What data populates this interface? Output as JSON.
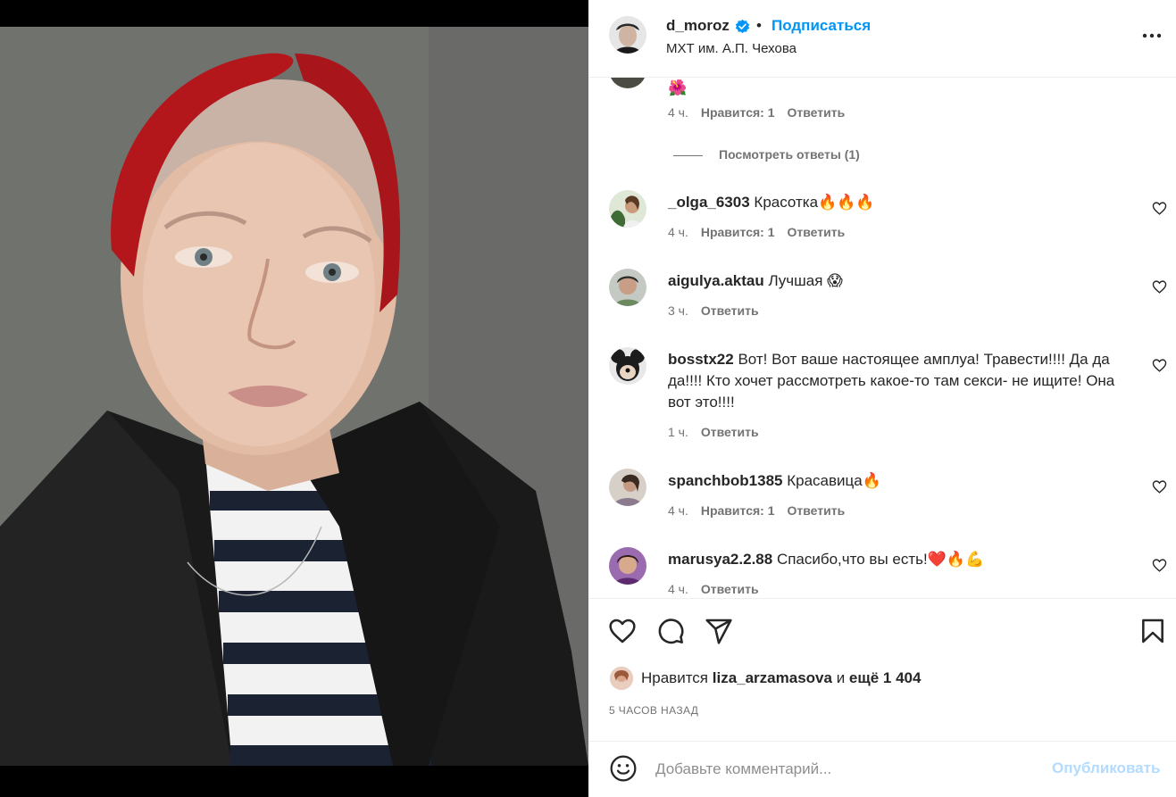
{
  "header": {
    "username": "d_moroz",
    "verified_icon": "verified-badge-icon",
    "separator": "•",
    "follow_label": "Подписаться",
    "location": "МХТ им. А.П. Чехова"
  },
  "comments": {
    "partial_top": {
      "emoji": "🌺",
      "time": "4 ч.",
      "likes": "Нравится: 1",
      "reply": "Ответить",
      "view_replies": "Посмотреть ответы (1)"
    },
    "items": [
      {
        "user": "_olga_6303",
        "text": "Красотка🔥🔥🔥",
        "time": "4 ч.",
        "likes": "Нравится: 1",
        "reply": "Ответить"
      },
      {
        "user": "aigulya.aktau",
        "text": "Лучшая 😱",
        "time": "3 ч.",
        "likes": "",
        "reply": "Ответить"
      },
      {
        "user": "bosstx22",
        "text": "Вот! Вот ваше настоящее амплуа! Травести!!!! Да да да!!!! Кто хочет рассмотреть какое-то там секси- не ищите! Она вот это!!!!",
        "time": "1 ч.",
        "likes": "",
        "reply": "Ответить"
      },
      {
        "user": "spanchbob1385",
        "text": "Красавица🔥",
        "time": "4 ч.",
        "likes": "Нравится: 1",
        "reply": "Ответить"
      },
      {
        "user": "marusya2.2.88",
        "text": "Спасибо,что вы есть!❤️🔥💪",
        "time": "4 ч.",
        "likes": "",
        "reply": "Ответить"
      }
    ]
  },
  "actions": {
    "like_icon": "heart-icon",
    "comment_icon": "comment-icon",
    "share_icon": "share-icon",
    "save_icon": "bookmark-icon"
  },
  "likes": {
    "prefix": "Нравится",
    "user": "liza_arzamasova",
    "middle": "и",
    "more": "ещё 1 404"
  },
  "posted": "5 ЧАСОВ НАЗАД",
  "add_comment": {
    "placeholder": "Добавьте комментарий...",
    "publish_label": "Опубликовать"
  },
  "colors": {
    "accent": "#0095f6",
    "publish_disabled": "#b3dbff",
    "secondary_text": "#737373"
  }
}
